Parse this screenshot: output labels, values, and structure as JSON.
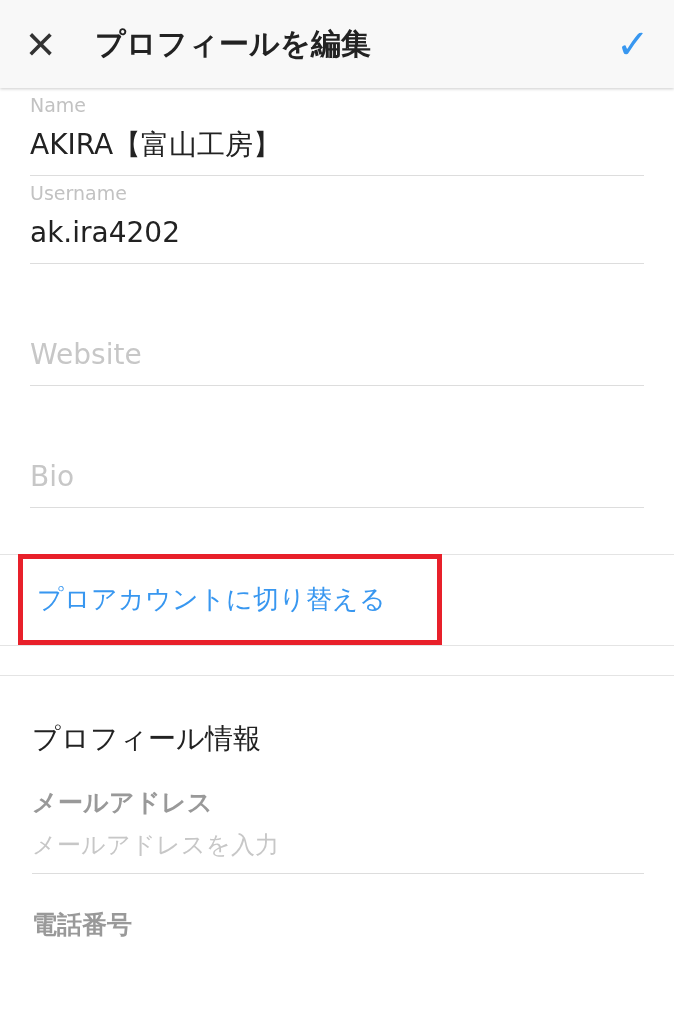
{
  "header": {
    "close": "×",
    "title": "プロフィールを編集",
    "confirm": "✓"
  },
  "fields": [
    {
      "label": "Name",
      "value": "AKIRA【富山工房】"
    },
    {
      "label": "Username",
      "value": "ak.ira4202"
    },
    {
      "placeholder": "Website"
    },
    {
      "placeholder": "Bio"
    }
  ],
  "switch_link": {
    "text": "プロアカウントに切り替える",
    "highlighted": true
  },
  "private_info": {
    "title": "プロフィール情報",
    "items": [
      {
        "label": "メールアドレス",
        "placeholder": "メールアドレスを入力"
      },
      {
        "label": "電話番号"
      }
    ]
  }
}
